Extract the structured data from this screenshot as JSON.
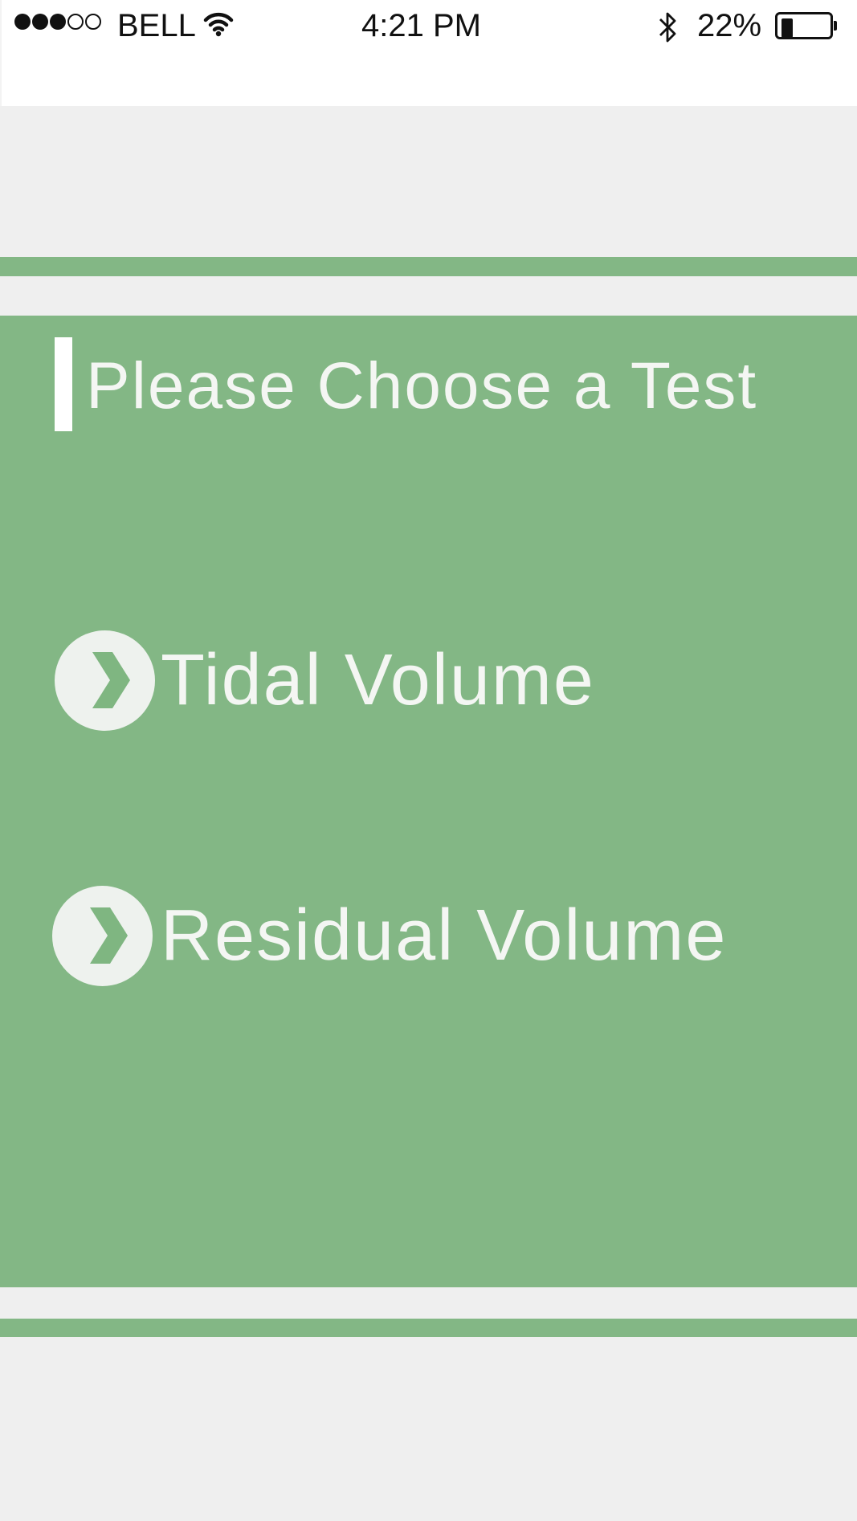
{
  "status_bar": {
    "carrier": "BELL",
    "signal_bars_filled": 3,
    "signal_bars_total": 5,
    "time": "4:21 PM",
    "battery_percent_label": "22%",
    "battery_level": 0.22,
    "icons": [
      "signal-icon",
      "wifi-icon",
      "bluetooth-icon",
      "battery-icon"
    ]
  },
  "main": {
    "title": "Please Choose a Test",
    "options": [
      {
        "label": "Tidal Volume",
        "icon": "chevron-right-icon"
      },
      {
        "label": "Residual Volume",
        "icon": "chevron-right-icon"
      }
    ]
  },
  "colors": {
    "accent_green": "#83b785",
    "background": "#efefef",
    "text_light": "#f4f6f3",
    "chevron_circle": "#eef2ee",
    "chevron": "#7fb681"
  }
}
